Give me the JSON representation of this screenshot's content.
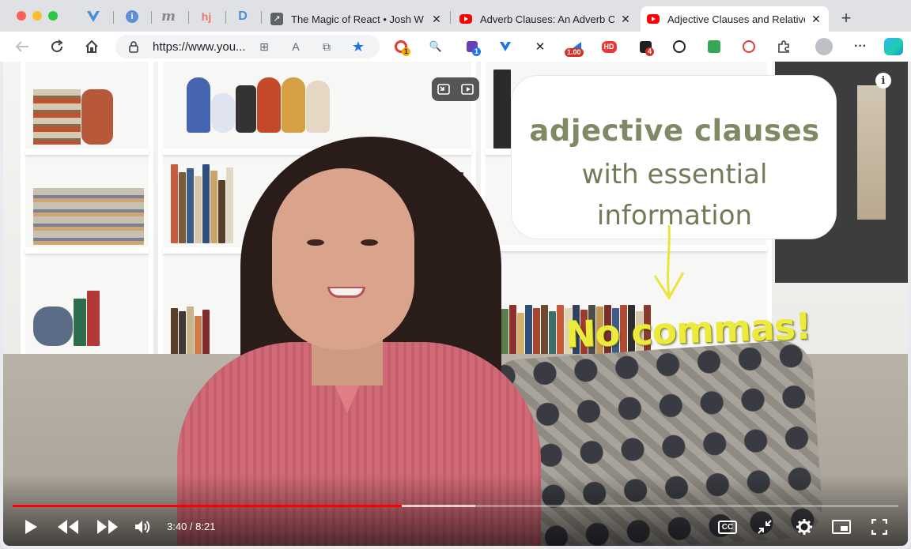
{
  "browser": {
    "tabs": [
      {
        "title": "The Magic of React • Josh W Comeau",
        "favicon": "arrow-icon",
        "active": false
      },
      {
        "title": "Adverb Clauses: An Adverb Clause",
        "favicon": "youtube-icon",
        "active": false
      },
      {
        "title": "Adjective Clauses and Relative",
        "favicon": "youtube-icon",
        "active": true
      }
    ],
    "pinned_tabs": [
      "vivaldi-icon",
      "info-icon",
      "m-icon",
      "hj-icon",
      "d-icon"
    ],
    "pinned_labels": {
      "m": "m",
      "hj": "hj",
      "info": "i",
      "d": "D"
    },
    "new_tab": "+",
    "close_glyph": "✕"
  },
  "toolbar": {
    "url": "https://www.you...",
    "extension_badges": {
      "ext1": "1",
      "ext3": "1",
      "ext6": "1.00",
      "ext7": "HD",
      "ext8": "4"
    },
    "more": "···"
  },
  "video": {
    "overlay": {
      "line1": "adjective clauses",
      "line2": "with essential",
      "line3": "information",
      "callout": "No commas!"
    },
    "info_label": "i",
    "time_current": "3:40",
    "time_total": "8:21",
    "time_display": "3:40 / 8:21",
    "progress_fraction": 0.439,
    "buffer_fraction": 0.522,
    "cc_label": "CC"
  },
  "colors": {
    "progress_played": "#ff0000",
    "overlay_text": "#7e8a64",
    "callout_text": "#ecea3a",
    "youtube_red": "#ff0000"
  }
}
